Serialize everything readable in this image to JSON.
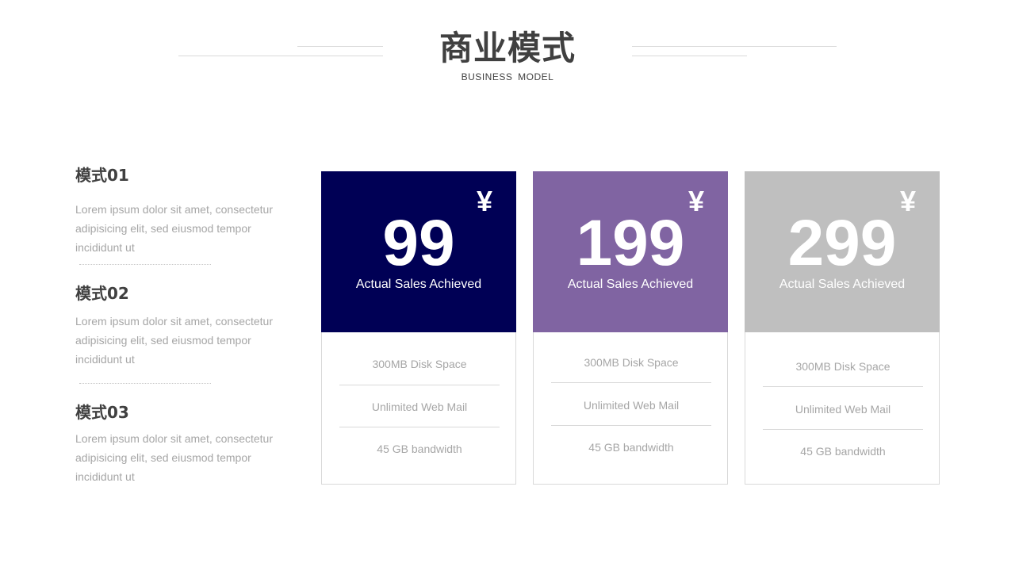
{
  "header": {
    "title": "商业模式",
    "subtitle": "BUSINESS  MODEL"
  },
  "modes": [
    {
      "title": "模式01",
      "desc": "Lorem ipsum dolor sit amet, consectetur adipisicing elit, sed eiusmod tempor incididunt ut"
    },
    {
      "title": "模式02",
      "desc": "Lorem ipsum dolor sit amet, consectetur adipisicing elit, sed eiusmod tempor incididunt ut"
    },
    {
      "title": "模式03",
      "desc": "Lorem ipsum dolor sit amet, consectetur adipisicing elit, sed eiusmod tempor incididunt ut"
    }
  ],
  "cards": [
    {
      "price": "99",
      "currency": "¥",
      "caption": "Actual Sales Achieved",
      "color": "#000055",
      "features": [
        "300MB Disk Space",
        "Unlimited Web Mail",
        "45 GB bandwidth"
      ]
    },
    {
      "price": "199",
      "currency": "¥",
      "caption": "Actual Sales Achieved",
      "color": "#8064a2",
      "features": [
        "300MB Disk Space",
        "Unlimited Web Mail",
        "45 GB bandwidth"
      ]
    },
    {
      "price": "299",
      "currency": "¥",
      "caption": "Actual Sales Achieved",
      "color": "#bfbfbf",
      "features": [
        "300MB Disk Space",
        "Unlimited Web Mail",
        "45 GB bandwidth"
      ]
    }
  ]
}
